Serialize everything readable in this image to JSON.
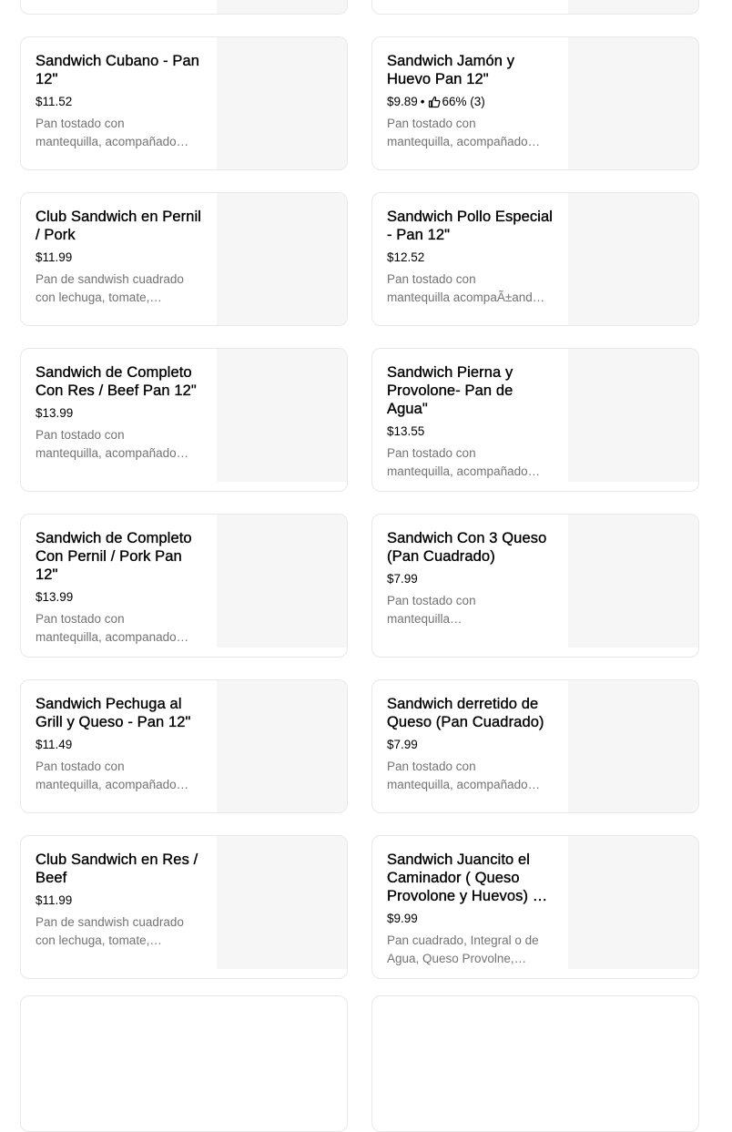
{
  "menu_items": {
    "left": [
      {
        "title_lines": [
          "Sandwich Cubano - Pan",
          "12\""
        ],
        "price": "$11.52",
        "desc_lines": [
          "Pan tostado con",
          "mantequilla, acompañado…"
        ]
      },
      {
        "title_lines": [
          "Club Sandwich en Pernil",
          "/ Pork"
        ],
        "price": "$11.99",
        "desc_lines": [
          "Pan de sandwish cuadrado",
          "con lechuga, tomate,…"
        ]
      },
      {
        "title_lines": [
          "Sandwich de Completo",
          "Con Res / Beef Pan 12\""
        ],
        "price": "$13.99",
        "desc_lines": [
          "Pan tostado con",
          "mantequilla, acompañado…"
        ]
      },
      {
        "title_lines": [
          "Sandwich de Completo",
          "Con Pernil / Pork Pan",
          "12\""
        ],
        "price": "$13.99",
        "desc_lines": [
          "Pan tostado con",
          "mantequilla, acompanado…"
        ]
      },
      {
        "title_lines": [
          "Sandwich Pechuga al",
          "Grill y Queso - Pan 12\""
        ],
        "price": "$11.49",
        "desc_lines": [
          "Pan tostado con",
          "mantequilla, acompañado…"
        ]
      },
      {
        "title_lines": [
          "Club Sandwich en Res /",
          "Beef"
        ],
        "price": "$11.99",
        "desc_lines": [
          "Pan de sandwish cuadrado",
          "con lechuga, tomate,…"
        ]
      }
    ],
    "right": [
      {
        "title_lines": [
          "Sandwich Jamón y",
          "Huevo Pan 12\""
        ],
        "price": "$9.89",
        "rating": "66% (3)",
        "desc_lines": [
          "Pan tostado con",
          "mantequilla, acompañado…"
        ]
      },
      {
        "title_lines": [
          "Sandwich Pollo Especial",
          "- Pan 12\""
        ],
        "price": "$12.52",
        "desc_lines": [
          "Pan tostado con",
          "mantequilla acompaÃ±and…"
        ]
      },
      {
        "title_lines": [
          "Sandwich Pierna y",
          "Provolone- Pan de",
          "Agua\""
        ],
        "price": "$13.55",
        "desc_lines": [
          "Pan tostado con",
          "mantequilla, acompañado…"
        ]
      },
      {
        "title_lines": [
          "Sandwich Con 3 Queso",
          "(Pan Cuadrado)"
        ],
        "price": "$7.99",
        "desc_lines": [
          "Pan tostado con",
          "mantequilla…"
        ]
      },
      {
        "title_lines": [
          "Sandwich derretido de",
          "Queso (Pan Cuadrado)"
        ],
        "price": "$7.99",
        "desc_lines": [
          "Pan tostado con",
          "mantequilla, acompañado…"
        ]
      },
      {
        "title_lines": [
          "Sandwich Juancito el",
          "Caminador ( Queso",
          "Provolone y Huevos) …"
        ],
        "price": "$9.99",
        "desc_lines": [
          "Pan cuadrado, Integral o de",
          "Agua, Queso Provolne,…"
        ]
      }
    ]
  },
  "rating_separator": "•",
  "icons": {
    "rating": "thumbs-up-icon"
  },
  "colors": {
    "description": "#737373",
    "image_placeholder": "#f6f6f6",
    "card_border": "#e8e8e8"
  }
}
